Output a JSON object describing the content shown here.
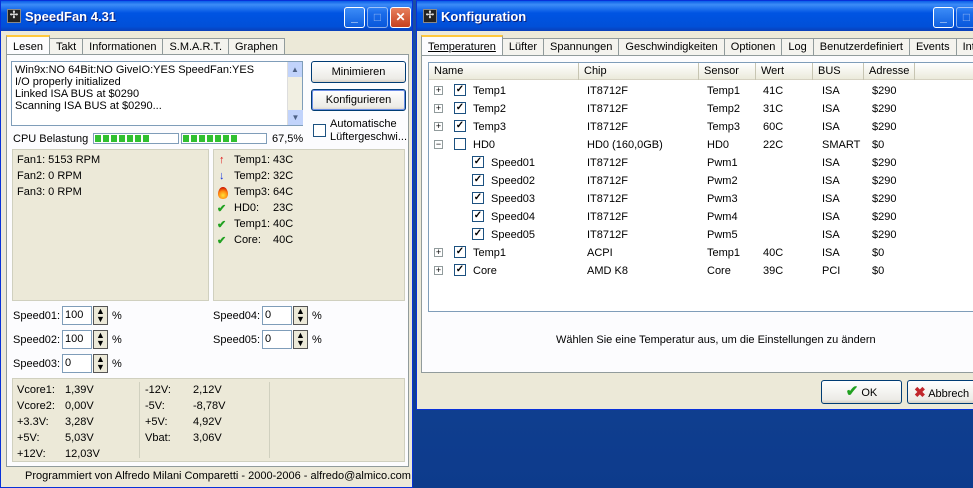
{
  "speedfan": {
    "title": "SpeedFan 4.31",
    "tabs": [
      "Lesen",
      "Takt",
      "Informationen",
      "S.M.A.R.T.",
      "Graphen"
    ],
    "log_lines": [
      "Win9x:NO  64Bit:NO  GiveIO:YES  SpeedFan:YES",
      "I/O properly initialized",
      "Linked ISA BUS at $0290",
      "Scanning ISA BUS at $0290..."
    ],
    "minimize_label": "Minimieren",
    "configure_label": "Konfigurieren",
    "auto_fan_label_1": "Automatische",
    "auto_fan_label_2": "Lüftergeschwi...",
    "cpu_label": "CPU Belastung",
    "cpu_percent": "67,5%",
    "cpu_load_fraction": 0.675,
    "fans": [
      "Fan1: 5153 RPM",
      "Fan2: 0 RPM",
      "Fan3: 0 RPM"
    ],
    "temps": [
      {
        "label": "Temp1:",
        "value": "43C",
        "icon": "arrow-up-icon"
      },
      {
        "label": "Temp2:",
        "value": "32C",
        "icon": "arrow-down-icon"
      },
      {
        "label": "Temp3:",
        "value": "64C",
        "icon": "flame-icon"
      },
      {
        "label": "HD0:",
        "value": "23C",
        "icon": "check-icon"
      },
      {
        "label": "Temp1:",
        "value": "40C",
        "icon": "check-icon"
      },
      {
        "label": "Core:",
        "value": "40C",
        "icon": "check-icon"
      }
    ],
    "speeds": [
      {
        "label": "Speed01:",
        "value": "100",
        "unit": "%"
      },
      {
        "label": "Speed02:",
        "value": "100",
        "unit": "%"
      },
      {
        "label": "Speed03:",
        "value": "0",
        "unit": "%"
      },
      {
        "label": "Speed04:",
        "value": "0",
        "unit": "%"
      },
      {
        "label": "Speed05:",
        "value": "0",
        "unit": "%"
      }
    ],
    "voltages_col1": [
      {
        "label": "Vcore1:",
        "value": "1,39V"
      },
      {
        "label": "Vcore2:",
        "value": "0,00V"
      },
      {
        "label": "+3.3V:",
        "value": "3,28V"
      },
      {
        "label": "+5V:",
        "value": "5,03V"
      },
      {
        "label": "+12V:",
        "value": "12,03V"
      }
    ],
    "voltages_col2": [
      {
        "label": "-12V:",
        "value": "2,12V"
      },
      {
        "label": "-5V:",
        "value": "-8,78V"
      },
      {
        "label": "+5V:",
        "value": "4,92V"
      },
      {
        "label": "Vbat:",
        "value": "3,06V"
      }
    ],
    "footer": "Programmiert von Alfredo Milani Comparetti - 2000-2006 - alfredo@almico.com"
  },
  "config": {
    "title": "Konfiguration",
    "tabs": [
      "Temperaturen",
      "Lüfter",
      "Spannungen",
      "Geschwindigkeiten",
      "Optionen",
      "Log",
      "Benutzerdefiniert",
      "Events",
      "Int"
    ],
    "columns": [
      "Name",
      "Chip",
      "Sensor",
      "Wert",
      "BUS",
      "Adresse"
    ],
    "rows": [
      {
        "name": "Temp1",
        "chip": "IT8712F",
        "sensor": "Temp1",
        "value": "41C",
        "bus": "ISA",
        "address": "$290",
        "expander": "+",
        "checked": true
      },
      {
        "name": "Temp2",
        "chip": "IT8712F",
        "sensor": "Temp2",
        "value": "31C",
        "bus": "ISA",
        "address": "$290",
        "expander": "+",
        "checked": true
      },
      {
        "name": "Temp3",
        "chip": "IT8712F",
        "sensor": "Temp3",
        "value": "60C",
        "bus": "ISA",
        "address": "$290",
        "expander": "+",
        "checked": true
      },
      {
        "name": "HD0",
        "chip": "HD0 (160,0GB)",
        "sensor": "HD0",
        "value": "22C",
        "bus": "SMART",
        "address": "$0",
        "expander": "−",
        "checked": false
      },
      {
        "name": "Speed01",
        "chip": "IT8712F",
        "sensor": "Pwm1",
        "value": "",
        "bus": "ISA",
        "address": "$290",
        "child": true,
        "checked": true
      },
      {
        "name": "Speed02",
        "chip": "IT8712F",
        "sensor": "Pwm2",
        "value": "",
        "bus": "ISA",
        "address": "$290",
        "child": true,
        "checked": true
      },
      {
        "name": "Speed03",
        "chip": "IT8712F",
        "sensor": "Pwm3",
        "value": "",
        "bus": "ISA",
        "address": "$290",
        "child": true,
        "checked": true
      },
      {
        "name": "Speed04",
        "chip": "IT8712F",
        "sensor": "Pwm4",
        "value": "",
        "bus": "ISA",
        "address": "$290",
        "child": true,
        "checked": true
      },
      {
        "name": "Speed05",
        "chip": "IT8712F",
        "sensor": "Pwm5",
        "value": "",
        "bus": "ISA",
        "address": "$290",
        "child": true,
        "checked": true
      },
      {
        "name": "Temp1",
        "chip": "ACPI",
        "sensor": "Temp1",
        "value": "40C",
        "bus": "ISA",
        "address": "$0",
        "expander": "+",
        "checked": true
      },
      {
        "name": "Core",
        "chip": "AMD K8",
        "sensor": "Core",
        "value": "39C",
        "bus": "PCI",
        "address": "$0",
        "expander": "+",
        "checked": true
      }
    ],
    "hint": "Wählen Sie eine Temperatur aus, um die Einstellungen zu ändern",
    "ok_label": "OK",
    "cancel_label": "Abbrech"
  },
  "colors": {
    "titlebar": "#0054e3",
    "window_bg": "#ece9d8",
    "desktop": "#0d3b8c",
    "check_green": "#21a121",
    "cancel_red": "#c1272d"
  }
}
